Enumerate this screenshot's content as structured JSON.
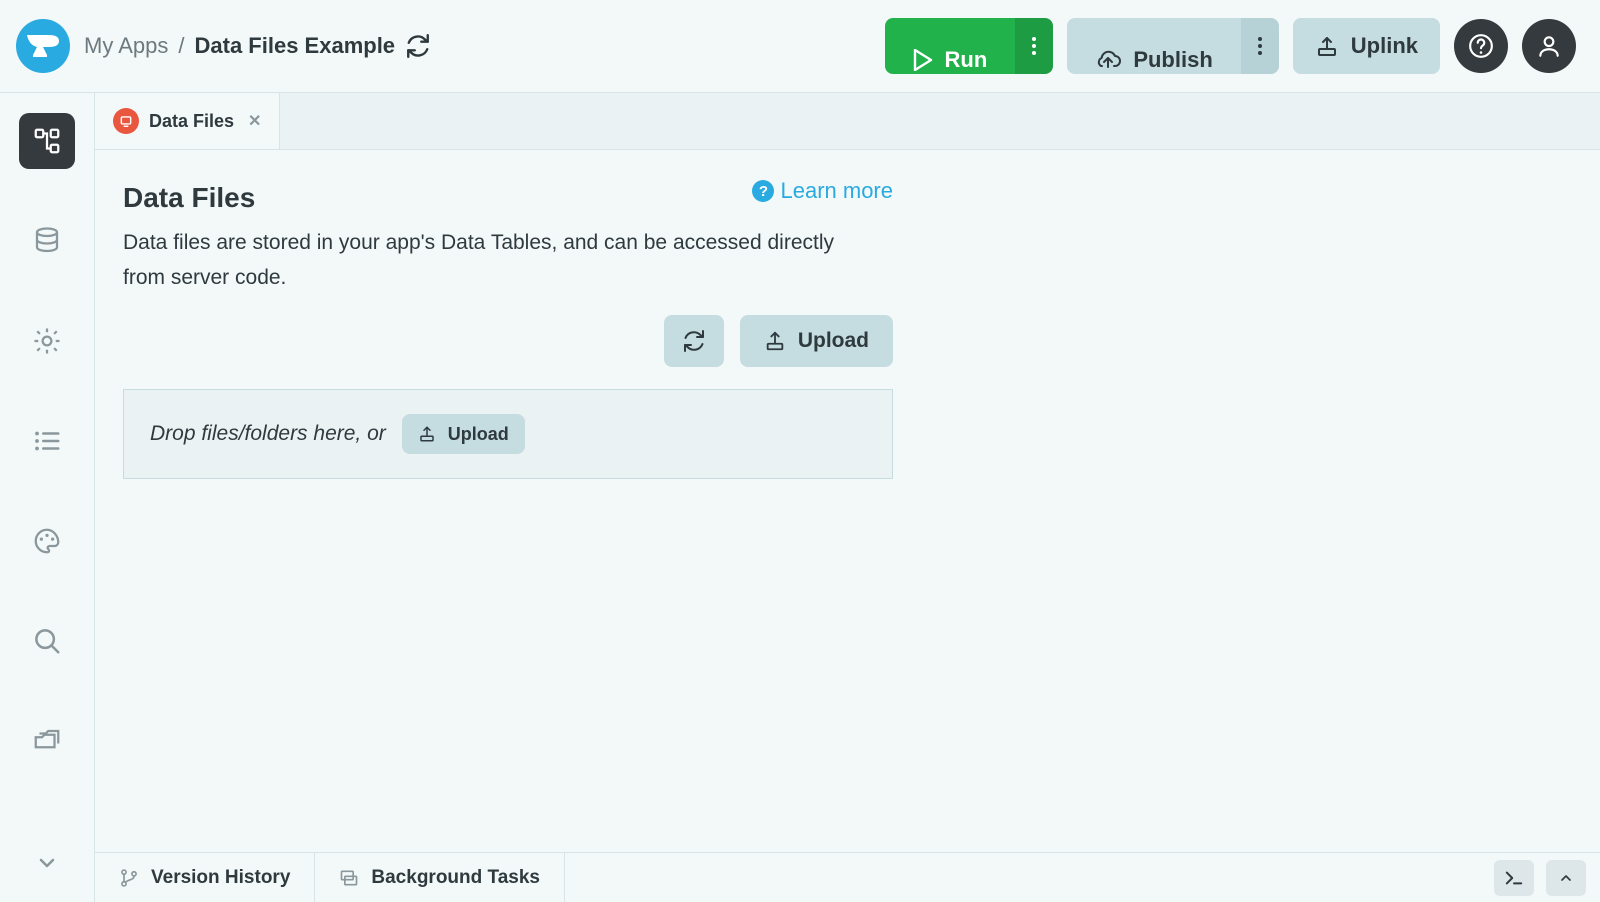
{
  "header": {
    "breadcrumb_root": "My Apps",
    "breadcrumb_sep": "/",
    "breadcrumb_current": "Data Files Example",
    "run_label": "Run",
    "publish_label": "Publish",
    "uplink_label": "Uplink"
  },
  "tab": {
    "label": "Data Files"
  },
  "panel": {
    "title": "Data Files",
    "description": "Data files are stored in your app's Data Tables, and can be accessed directly from server code.",
    "learn_more": "Learn more",
    "upload_label": "Upload",
    "drop_hint": "Drop files/folders here, or",
    "drop_upload_label": "Upload"
  },
  "bottom": {
    "version_history": "Version History",
    "background_tasks": "Background Tasks"
  }
}
